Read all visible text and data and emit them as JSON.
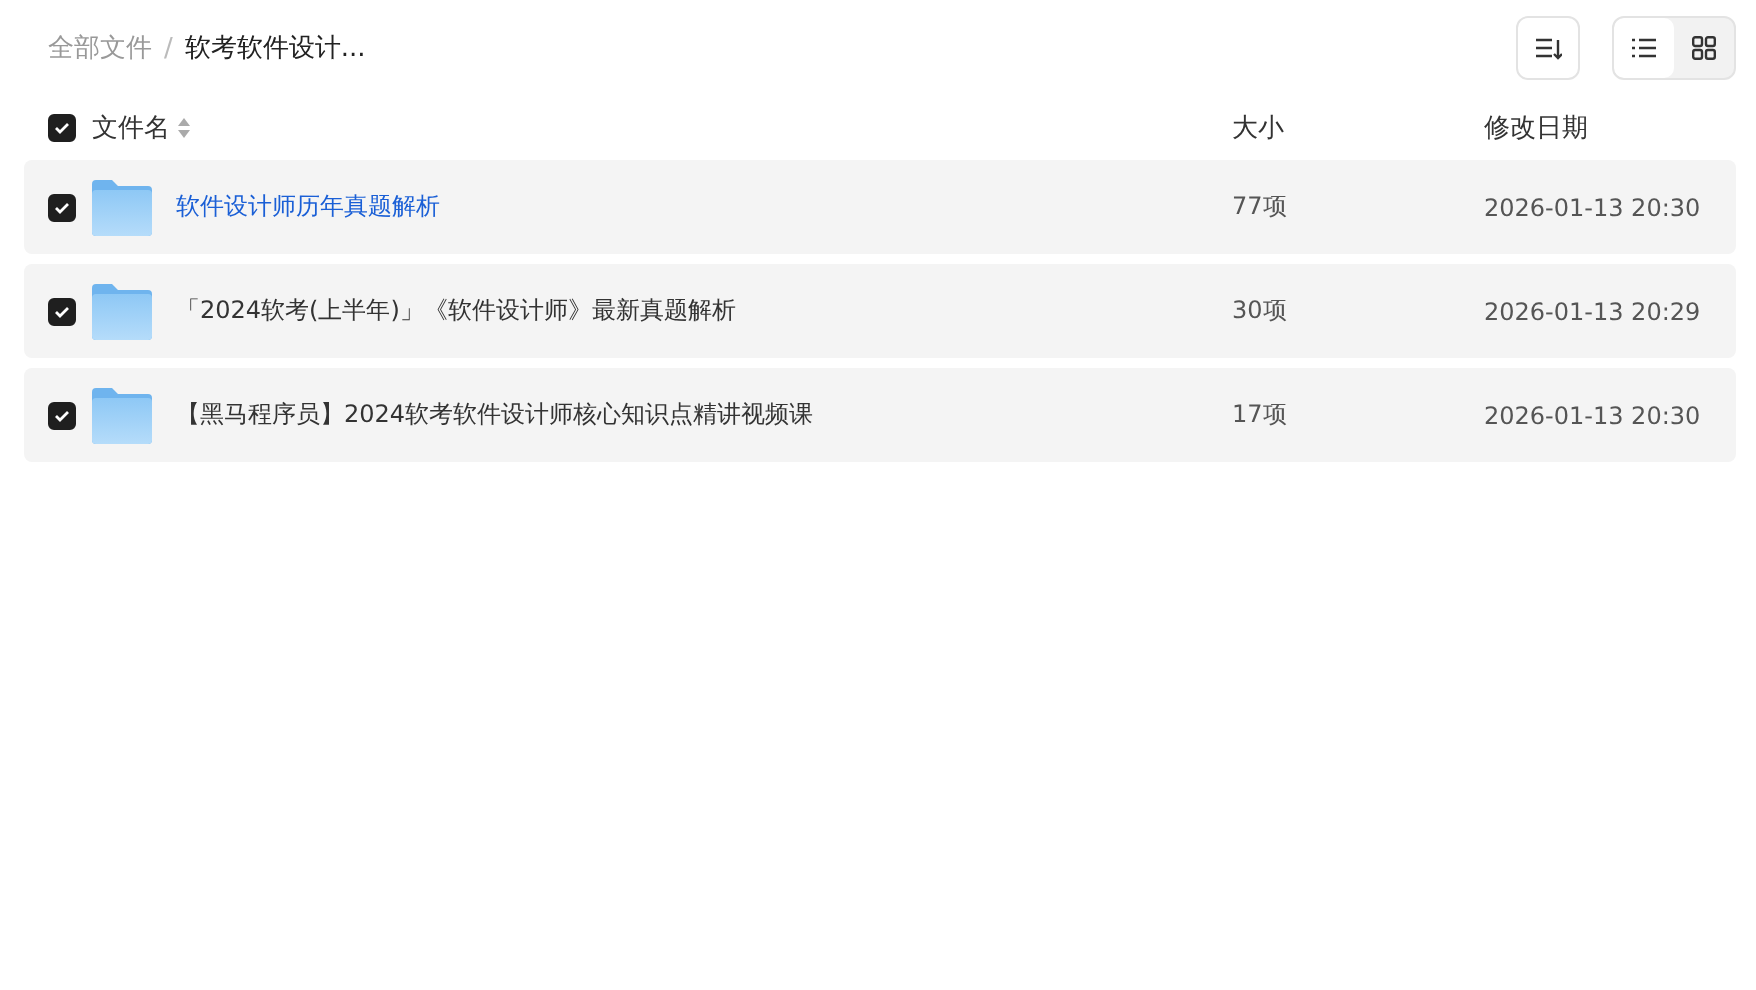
{
  "breadcrumb": [
    {
      "label": "全部文件",
      "current": false
    },
    {
      "label": "软考软件设计...",
      "current": true
    }
  ],
  "separator": "/",
  "view_modes": [
    {
      "kind": "list",
      "selected": true
    },
    {
      "kind": "grid",
      "selected": false
    }
  ],
  "header": {
    "checked": true,
    "columns": [
      "文件名",
      "大小",
      "修改日期"
    ]
  },
  "rows": [
    {
      "name": "软件设计师历年真题解析",
      "size": "77项",
      "date": "2026-01-13 20:30",
      "checked": true,
      "hovered": true
    },
    {
      "name": "「2024软考(上半年)」《软件设计师》最新真题解析",
      "size": "30项",
      "date": "2026-01-13 20:29",
      "checked": true,
      "hovered": false
    },
    {
      "name": "【黑马程序员】2024软考软件设计师核心知识点精讲视频课",
      "size": "17项",
      "date": "2026-01-13 20:30",
      "checked": true,
      "hovered": false
    }
  ]
}
